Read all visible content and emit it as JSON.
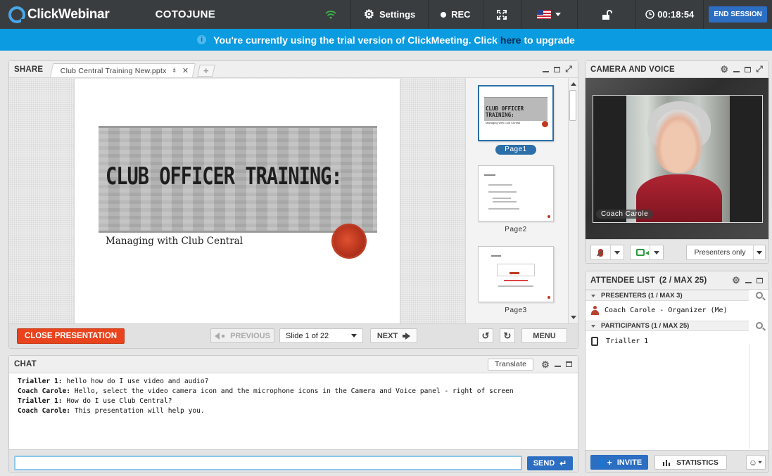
{
  "app": {
    "brand": "ClickWebinar",
    "meeting_name": "COTOJUNE"
  },
  "toolbar": {
    "settings_label": "Settings",
    "rec_label": "REC",
    "timer": "00:18:54",
    "end_session_label": "END SESSION",
    "icons": [
      "wifi-signal-icon",
      "gear-icon",
      "record-dot-icon",
      "fullscreen-icon",
      "us-flag-icon",
      "unlock-icon",
      "clock-icon"
    ]
  },
  "banner": {
    "text_before": "You're currently using the trial version of ClickMeeting. Click",
    "link_text": "here",
    "text_after": "to upgrade"
  },
  "share": {
    "title": "SHARE",
    "tab_file": "Club Central Training New.pptx",
    "slide": {
      "title": "CLUB OFFICER TRAINING:",
      "subtitle": "Managing with Club Central"
    },
    "thumb1": {
      "title": "CLUB OFFICER TRAINING:",
      "subtitle": "Managing with Club Central"
    },
    "thumbnails": [
      {
        "label": "Page1",
        "selected": true
      },
      {
        "label": "Page2",
        "selected": false
      },
      {
        "label": "Page3",
        "selected": false
      }
    ],
    "close_label": "CLOSE PRESENTATION",
    "prev_label": "PREVIOUS",
    "slide_select": "Slide 1 of 22",
    "next_label": "NEXT",
    "menu_label": "MENU"
  },
  "chat": {
    "title": "CHAT",
    "translate_label": "Translate",
    "messages": [
      {
        "author": "Trialler 1:",
        "text": "hello how do I use video and audio?"
      },
      {
        "author": "Coach Carole:",
        "text": "Hello, select the video camera icon and the microphone icons in the Camera and Voice panel - right of screen"
      },
      {
        "author": "Trialler 1:",
        "text": "How do I use Club Central?"
      },
      {
        "author": "Coach Carole:",
        "text": "This presentation will help you."
      }
    ],
    "input_value": "",
    "send_label": "SEND"
  },
  "camera": {
    "title": "CAMERA AND VOICE",
    "video_name": "Coach Carole",
    "presenters_only_label": "Presenters only"
  },
  "attendees": {
    "title": "ATTENDEE LIST",
    "count": "(2 / MAX 25)",
    "presenters_header": "PRESENTERS (1 / MAX 3)",
    "presenters": [
      {
        "name": "Coach Carole - Organizer (Me)"
      }
    ],
    "participants_header": "PARTICIPANTS (1 / MAX 25)",
    "participants": [
      {
        "name": "Trialler 1"
      }
    ],
    "invite_label": "INVITE",
    "statistics_label": "STATISTICS"
  },
  "colors": {
    "topbar": "#3a3d40",
    "banner": "#0b9be0",
    "accent_blue": "#2b6ec2",
    "close_red": "#e8431c"
  }
}
